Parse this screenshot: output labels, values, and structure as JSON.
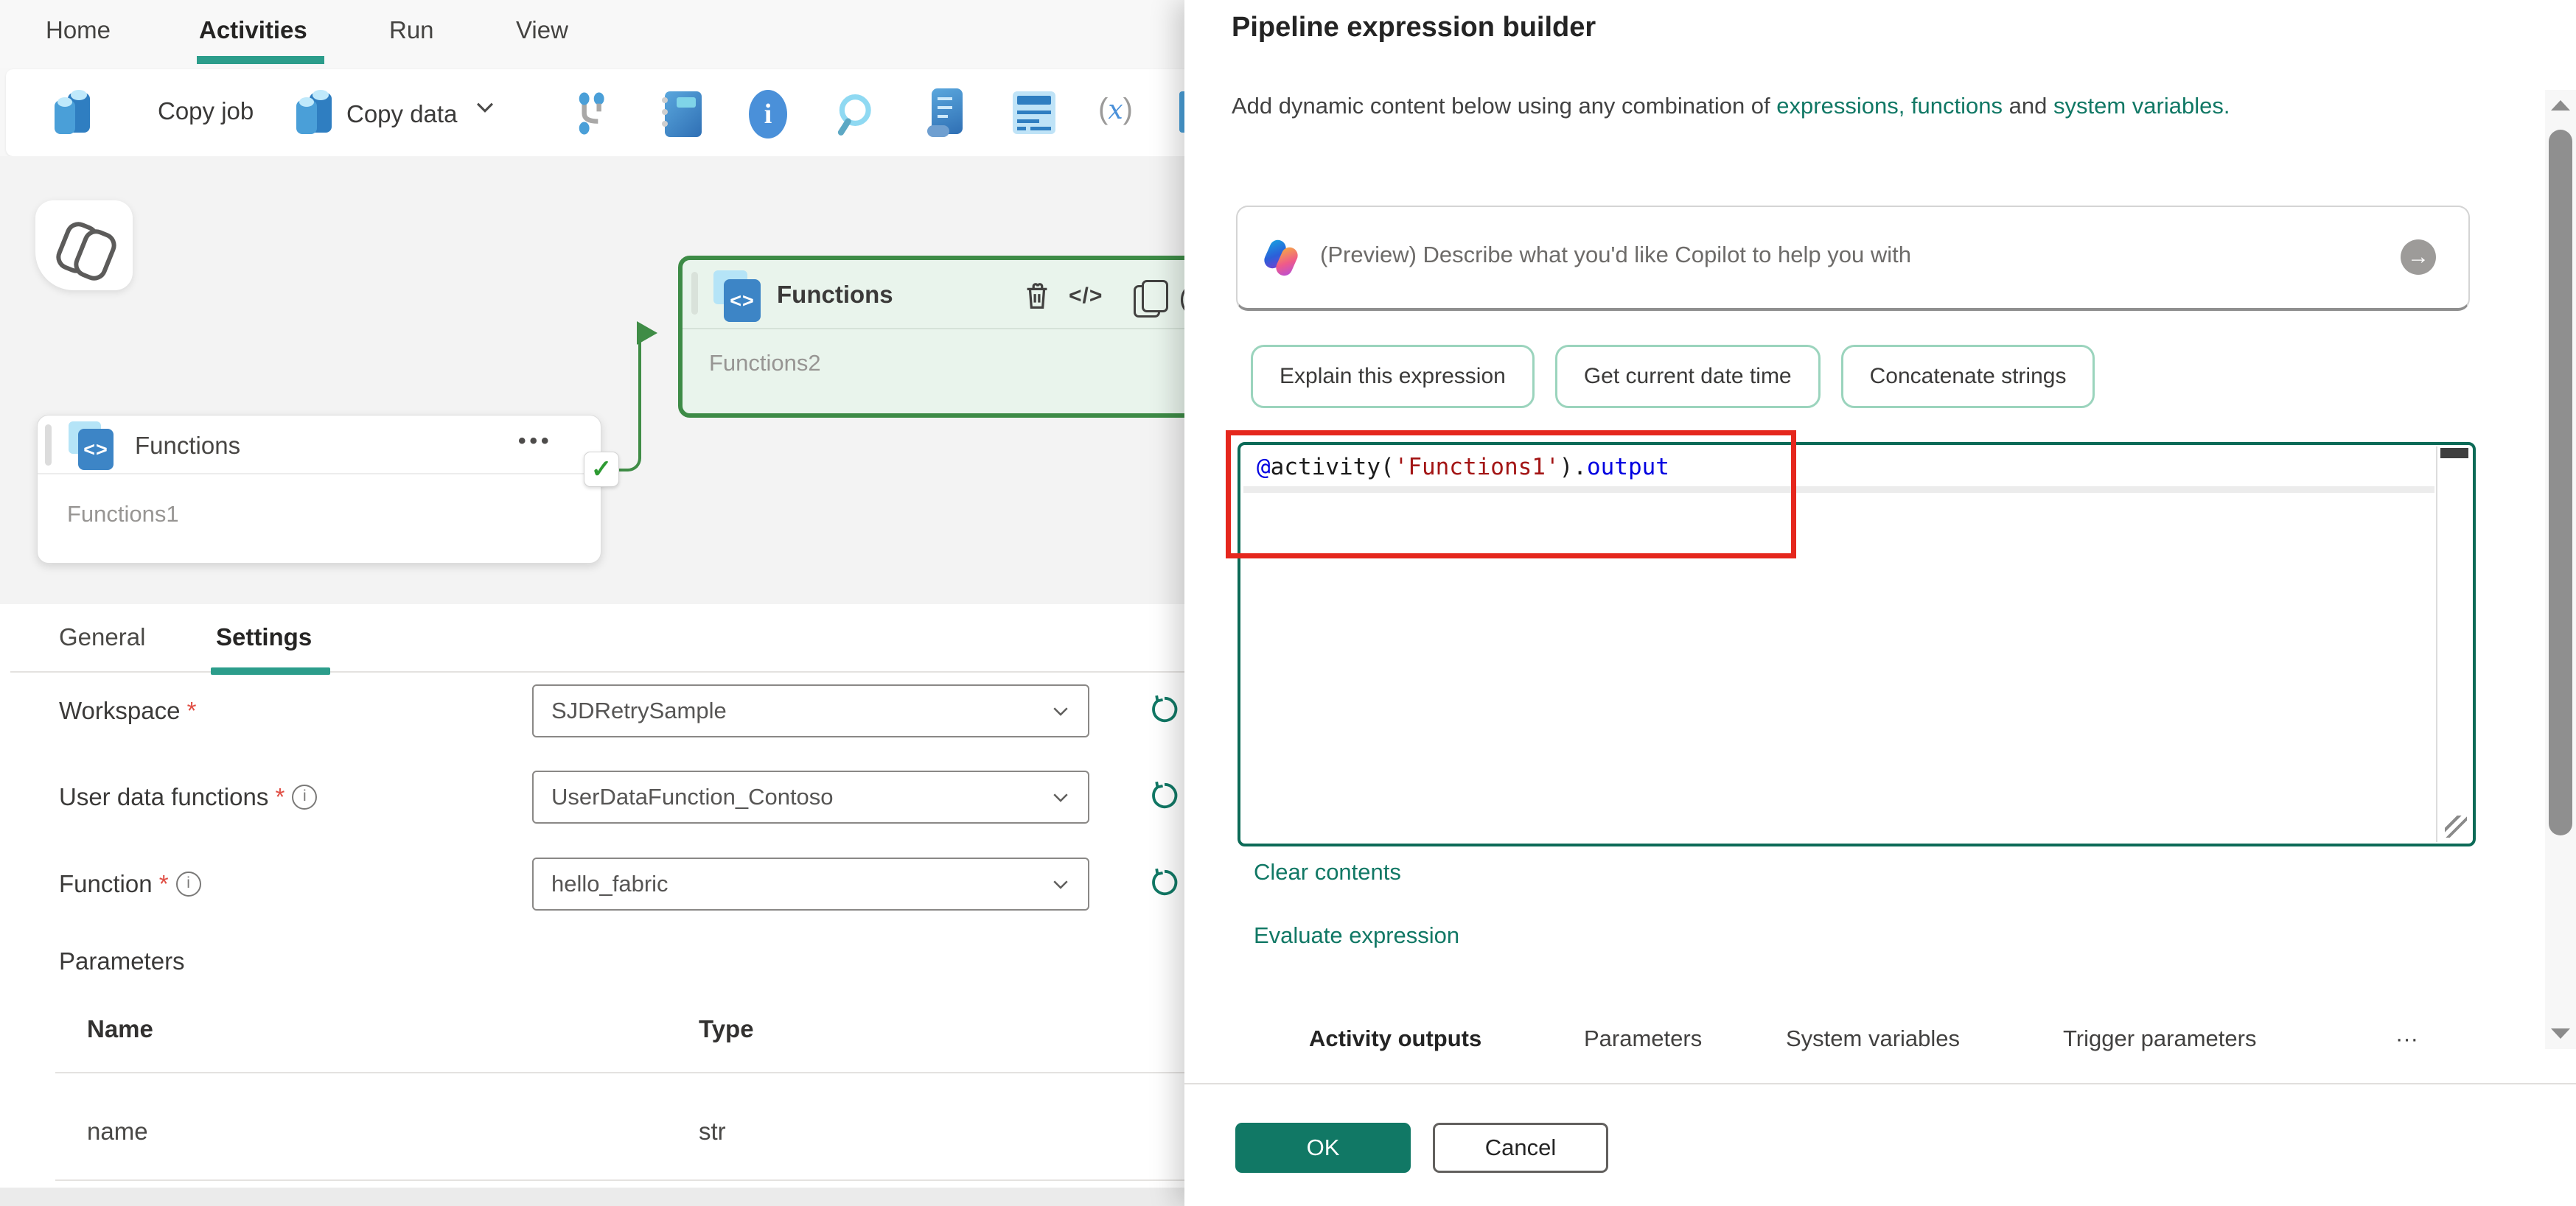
{
  "colors": {
    "accent_teal": "#117865",
    "tab_underline": "#2c9d8b",
    "selection_green": "#3d8b46",
    "annotation_red": "#e5271d",
    "code_keyword_blue": "#0000e0",
    "code_string_red": "#a31515",
    "pill_border_mint": "#9bd4bd"
  },
  "menu": {
    "items": [
      {
        "label": "Home"
      },
      {
        "label": "Activities"
      },
      {
        "label": "Run"
      },
      {
        "label": "View"
      }
    ],
    "active": "Activities"
  },
  "toolbar": {
    "copy_job_label": "Copy job",
    "copy_data_label": "Copy data",
    "icon_names": [
      "branch-icon",
      "notebook-icon",
      "info-icon",
      "search-icon",
      "script-icon",
      "list-form-icon",
      "function-fx-icon"
    ]
  },
  "canvas": {
    "copilot_button": "copilot",
    "selected_activity": {
      "title": "Functions",
      "name": "Functions2",
      "header_icons": [
        "delete-icon",
        "code-icon",
        "copy-icon",
        "clock-icon"
      ]
    },
    "activity": {
      "title": "Functions",
      "name": "Functions1",
      "status_check": "✓",
      "more_menu": "•••"
    },
    "fn_icon_glyph": "<>"
  },
  "properties": {
    "tabs": [
      {
        "label": "General"
      },
      {
        "label": "Settings"
      }
    ],
    "active_tab": "Settings",
    "fields": [
      {
        "label": "Workspace",
        "required": "*",
        "value": "SJDRetrySample"
      },
      {
        "label": "User data functions",
        "required": "*",
        "info": "i",
        "value": "UserDataFunction_Contoso"
      },
      {
        "label": "Function",
        "required": "*",
        "info": "i",
        "value": "hello_fabric"
      }
    ],
    "parameters": {
      "heading": "Parameters",
      "columns": [
        "Name",
        "Type"
      ],
      "rows": [
        {
          "name": "name",
          "type": "str"
        }
      ]
    }
  },
  "panel": {
    "title": "Pipeline expression builder",
    "description": {
      "prefix": "Add dynamic content below using any combination of ",
      "link_expressions": "expressions,",
      "mid1": " ",
      "link_functions": "functions",
      "mid2": " and ",
      "link_system_variables": "system variables."
    },
    "copilot": {
      "placeholder": "(Preview) Describe what you'd like Copilot to help you with",
      "send_icon": "→"
    },
    "suggestions": [
      {
        "label": "Explain this expression"
      },
      {
        "label": "Get current date time"
      },
      {
        "label": "Concatenate strings"
      }
    ],
    "expression": {
      "full": "@activity('Functions1').output",
      "tokens": [
        {
          "text": "@",
          "style": "kw"
        },
        {
          "text": "activity",
          "style": "plain"
        },
        {
          "text": "(",
          "style": "plain"
        },
        {
          "text": "'Functions1'",
          "style": "str"
        },
        {
          "text": ")",
          "style": "plain"
        },
        {
          "text": ".",
          "style": "plain"
        },
        {
          "text": "output",
          "style": "kw"
        }
      ]
    },
    "links": {
      "clear": "Clear contents",
      "evaluate": "Evaluate expression"
    },
    "tabs": [
      {
        "label": "Activity outputs"
      },
      {
        "label": "Parameters"
      },
      {
        "label": "System variables"
      },
      {
        "label": "Trigger parameters"
      },
      {
        "label": "···"
      }
    ],
    "active_tab": "Activity outputs",
    "buttons": {
      "ok": "OK",
      "cancel": "Cancel"
    }
  }
}
